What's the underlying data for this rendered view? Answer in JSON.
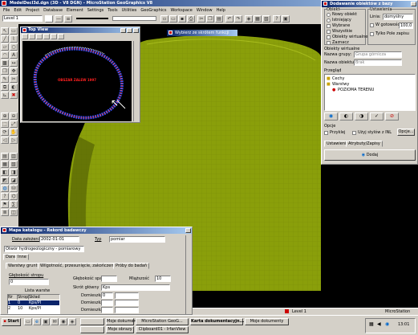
{
  "app": {
    "title": "ModelDecl3d.dgn (3D - V8 DGN) - MicroStation GeoGraphics V8",
    "menu": [
      "File",
      "Edit",
      "Project",
      "Database",
      "Element",
      "Settings",
      "Tools",
      "Utilities",
      "GeoGraphics",
      "Workspace",
      "Window",
      "Help"
    ],
    "level_value": "Level 1"
  },
  "colors": {
    "terrain": "#8a9f0a",
    "title_bar": "#0a246a",
    "map_outline": "#ff3c3c"
  },
  "view_window": {
    "title": "Top View",
    "map_label": "OBSZAR ZALEW 1997"
  },
  "floating_title": "Wybierz ze skrótem funkcji",
  "dialog_right": {
    "title": "Dodawanie obiektów z bazy",
    "section_obiekt": "Obiekt",
    "rb_nowy": "Nowy obiekt",
    "rb_istniejacy": "Istniejący",
    "cb_wybrane": "Wybrane",
    "cb_wszystkie": "Wszystkie",
    "cb_obiekty_wirtualne": "Obiekty wirtualne",
    "cb_zaznacz": "Zaznacz",
    "lbl_ustawienia": "Ustawienia",
    "lbl_linia": "Linia:",
    "linia_value": "domyślny",
    "cb_w_gotowosci": "W gotowości",
    "gotowosc_value": "100,0",
    "cb_tylko_pole": "Tylko Pole zapisu",
    "section_obiekt_wirtualny": "Obiekty wirtualne",
    "lbl_nazwa_grupy": "Nazwa grupy:",
    "nazwa_grupy_value": "Grupa górnicza",
    "lbl_nazwa_obiektu": "Nazwa obiektu:",
    "nazwa_obiektu_value": "Brak",
    "section_przeglad": "Przegląd",
    "tree": [
      "Cechy",
      "Warstwy",
      "POZIOMA TERENU"
    ],
    "section_opcje": "Opcje",
    "cb_przyklej": "Przyklej",
    "cb_uzyj_stylow": "Użyj stylów z INL",
    "btn_opcje": "Opcje...",
    "tabs": [
      "Ustawienia",
      "Atrybuty/Zapisy"
    ],
    "btn_dodaj": "Dodaj"
  },
  "dialog_left": {
    "title": "Mapa katalogu - Rekord badawczy",
    "lbl_data": "Data założenia",
    "data_value": "2002-01-01",
    "lbl_typ": "Typ",
    "typ_value": "pomiar",
    "opis_value": "Otwór hydrogeologiczny - pomiarowy",
    "subtabs": [
      "Dane",
      "Inne"
    ],
    "tabs": [
      "Warstwy gruntu",
      "Wilgotność, przesunięcie, zakończenie, Stratyfikacja",
      "Próby do badań"
    ],
    "lbl_glebokosc_stropu": "Głębokość stropu",
    "glebokosc_stropu_value": "0",
    "lbl_glebokosc_spagu": "Głębokość spągu",
    "glebokosc_spagu_value": "",
    "lbl_miazszosc": "Miąższość",
    "miazszosc_value": "10",
    "lbl_skrot_glowny": "Skrót główny",
    "skrot_glowny_value": "Kps",
    "lbl_domieszka": "Domieszka",
    "domieszka_vals": [
      "0",
      "",
      "",
      ""
    ],
    "lbl_numer": "Lista warstw",
    "table_headers": [
      "Nr",
      "Strop",
      "Skład"
    ],
    "table_rows": [
      [
        "1",
        "0",
        "Kps/Pl"
      ],
      [
        "2",
        "10",
        "Kps/Pl"
      ]
    ]
  },
  "status_bar": {
    "level": "Level 1",
    "app_name": "MicroStation"
  },
  "taskbar": {
    "start": "Start",
    "tasks_row1": [
      "",
      "Moje dokumenty",
      "MicroStation GeoG...",
      "Karta dokumentacyjn...",
      "Moje dokumenty"
    ],
    "tasks_row2": [
      "",
      "Moje obrazy",
      "Clipboard01 - IrfanView"
    ],
    "clock": "13:01"
  }
}
